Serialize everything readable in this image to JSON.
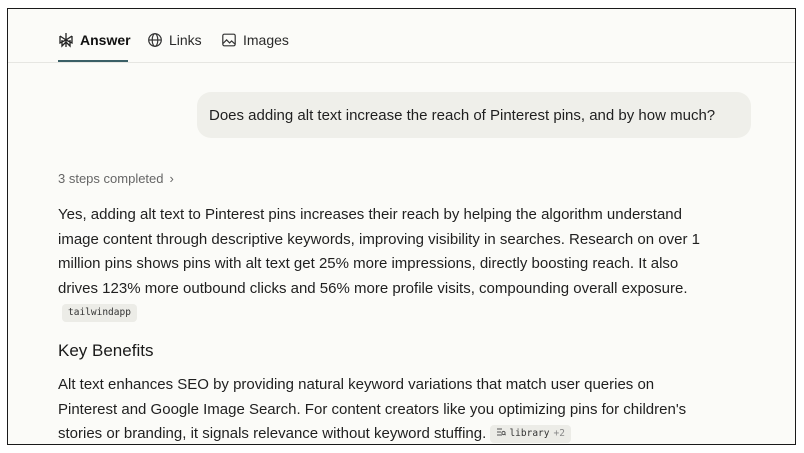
{
  "tabs": [
    {
      "label": "Answer",
      "icon": "perplexity-icon",
      "active": true
    },
    {
      "label": "Links",
      "icon": "globe-icon",
      "active": false
    },
    {
      "label": "Images",
      "icon": "image-icon",
      "active": false
    }
  ],
  "query": "Does adding alt text increase the reach of Pinterest pins, and by how much?",
  "steps_label": "3 steps completed",
  "answer_lines": [
    "Yes, adding alt text to Pinterest pins increases their reach by helping the algorithm understand",
    "image content through descriptive keywords, improving visibility in searches. Research on over 1",
    "million pins shows pins with alt text get 25% more impressions, directly boosting reach. It also",
    "drives 123% more outbound clicks and 56% more profile visits, compounding overall exposure."
  ],
  "source_1": "tailwindapp",
  "section_heading": "Key Benefits",
  "section_lines": [
    "Alt text enhances SEO by providing natural keyword variations that match user queries on",
    "Pinterest and Google Image Search. For content creators like you optimizing pins for children's",
    "stories or branding, it signals relevance without keyword stuffing."
  ],
  "source_2": {
    "label": "library",
    "count": "+2"
  },
  "colors": {
    "accent": "#3a5f66",
    "bubble": "#efefea",
    "background": "#fbfbf8"
  }
}
